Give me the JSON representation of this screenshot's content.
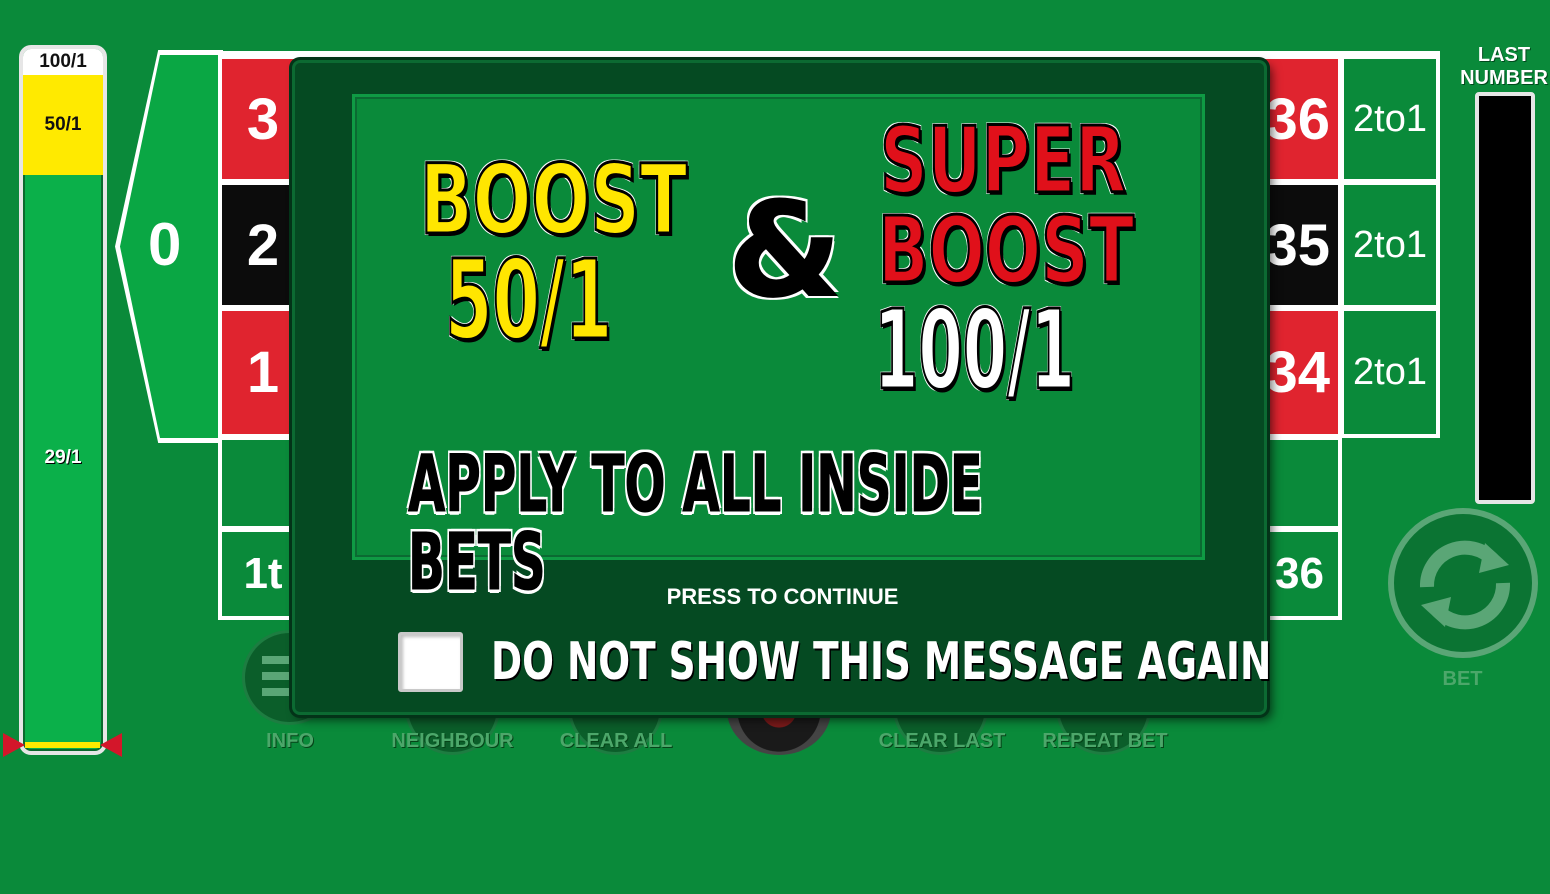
{
  "meter": {
    "top_label": "100/1",
    "boost_label": "50/1",
    "base_label": "29/1",
    "colors": {
      "fill": "#0bb04a",
      "boost": "#ffea00",
      "marker": "#d3162a"
    }
  },
  "table": {
    "zero": "0",
    "left_column": [
      {
        "label": "3",
        "color": "red"
      },
      {
        "label": "2",
        "color": "black"
      },
      {
        "label": "1",
        "color": "red"
      }
    ],
    "right_column": [
      {
        "label": "36",
        "color": "red"
      },
      {
        "label": "35",
        "color": "black"
      },
      {
        "label": "34",
        "color": "red"
      }
    ],
    "column_bets": [
      "2to1",
      "2to1",
      "2to1"
    ],
    "dozen_left": "1t",
    "dozen_right": "36"
  },
  "last_number": {
    "label": "LAST NUMBER"
  },
  "bet_button": {
    "label": "BET",
    "icon": "refresh-icon"
  },
  "controls": {
    "info": "INFO",
    "neighbour": "NEIGHBOUR",
    "clear_all": "CLEAR ALL",
    "clear_last": "CLEAR LAST",
    "repeat_bet": "REPEAT BET"
  },
  "modal": {
    "boost_title": "BOOST",
    "boost_odds": "50/1",
    "ampersand": "&",
    "super_line1": "SUPER",
    "super_line2": "BOOST",
    "super_odds": "100/1",
    "apply_text": "APPLY TO ALL INSIDE BETS",
    "continue_text": "PRESS TO CONTINUE",
    "checkbox_label": "DO NOT SHOW THIS MESSAGE AGAIN",
    "checkbox_checked": false,
    "colors": {
      "boost": "#ffe600",
      "super_boost": "#e0101a",
      "panel": "#054a22"
    }
  }
}
